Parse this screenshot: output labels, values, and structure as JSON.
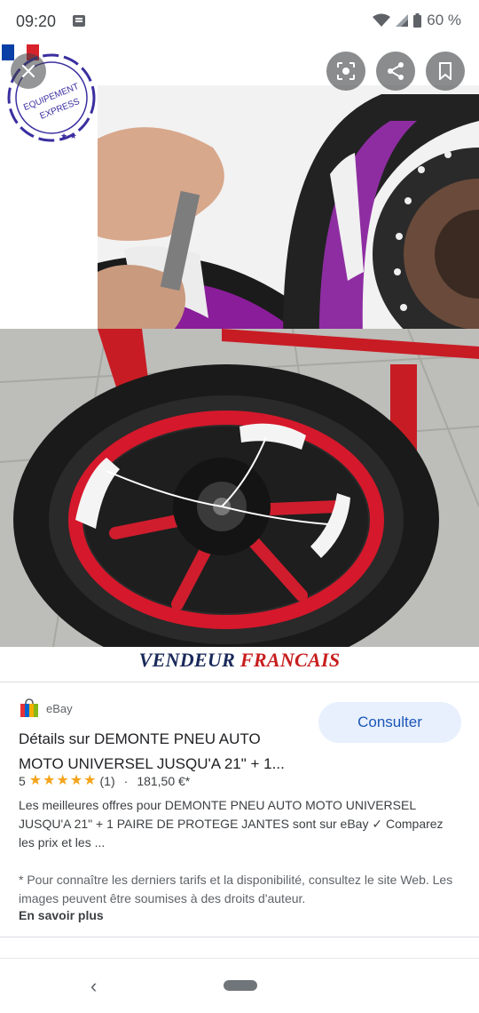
{
  "status_bar": {
    "time": "09:20",
    "battery_text": "60 %",
    "icons": [
      "message-icon",
      "wifi-icon",
      "signal-icon",
      "battery-icon"
    ]
  },
  "viewer": {
    "close_icon": "close-icon",
    "lens_icon": "lens-icon",
    "share_icon": "share-icon",
    "save_icon": "bookmark-icon",
    "stamp_text": "EQUIPEMENT EXPRESS",
    "banner_part1": "VENDEUR",
    "banner_part2": "FRANCAIS"
  },
  "result": {
    "source_name": "eBay",
    "consult_label": "Consulter",
    "title": "Détails sur DEMONTE PNEU AUTO MOTO UNIVERSEL JUSQU'A 21\" + 1...",
    "rating_value": "5",
    "rating_stars": 5,
    "rating_count": "(1)",
    "separator": "·",
    "price": "181,50 €*",
    "description": "Les meilleures offres pour DEMONTE PNEU AUTO MOTO UNIVERSEL JUSQU'A 21\" + 1 PAIRE DE PROTEGE JANTES sont sur eBay ✓ Comparez les prix et les ...",
    "disclaimer": "* Pour connaître les derniers tarifs et la disponibilité, consultez le site Web. Les images peuvent être soumises à des droits d'auteur.",
    "learn_more": "En savoir plus"
  },
  "nav": {
    "back_icon": "back-icon",
    "home_icon": "home-pill"
  },
  "colors": {
    "accent": "#1a56b8",
    "button_bg": "#e8f0fe",
    "star": "#f4a41c",
    "banner_blue": "#1a2a5a",
    "banner_red": "#c81e1e"
  }
}
